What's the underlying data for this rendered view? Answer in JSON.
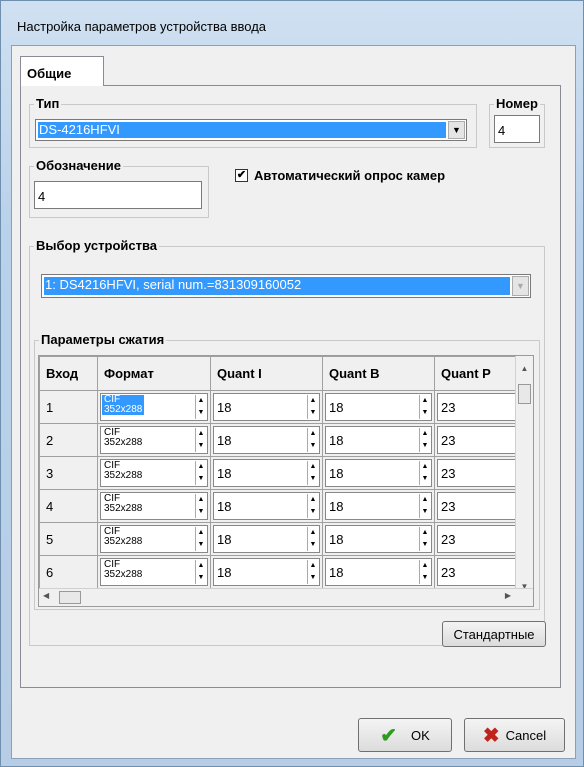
{
  "window": {
    "title": "Настройка параметров устройства ввода"
  },
  "tabs": [
    {
      "label": "Общие"
    }
  ],
  "type": {
    "label": "Тип",
    "value": "DS-4216HFVI"
  },
  "number": {
    "label": "Номер",
    "value": "4"
  },
  "designation": {
    "label": "Обозначение",
    "value": "4"
  },
  "auto_poll": {
    "label": "Автоматический опрос камер",
    "checked": true
  },
  "device_select": {
    "label": "Выбор устройства",
    "value": "1: DS4216HFVI, serial num.=831309160052"
  },
  "compression": {
    "label": "Параметры сжатия",
    "columns": [
      "Вход",
      "Формат",
      "Quant I",
      "Quant B",
      "Quant P"
    ],
    "rows": [
      {
        "input": "1",
        "format_name": "CIF",
        "format_res": "352x288",
        "quant_i": "18",
        "quant_b": "18",
        "quant_p": "23"
      },
      {
        "input": "2",
        "format_name": "CIF",
        "format_res": "352x288",
        "quant_i": "18",
        "quant_b": "18",
        "quant_p": "23"
      },
      {
        "input": "3",
        "format_name": "CIF",
        "format_res": "352x288",
        "quant_i": "18",
        "quant_b": "18",
        "quant_p": "23"
      },
      {
        "input": "4",
        "format_name": "CIF",
        "format_res": "352x288",
        "quant_i": "18",
        "quant_b": "18",
        "quant_p": "23"
      },
      {
        "input": "5",
        "format_name": "CIF",
        "format_res": "352x288",
        "quant_i": "18",
        "quant_b": "18",
        "quant_p": "23"
      },
      {
        "input": "6",
        "format_name": "CIF",
        "format_res": "352x288",
        "quant_i": "18",
        "quant_b": "18",
        "quant_p": "23"
      }
    ]
  },
  "buttons": {
    "defaults": "Стандартные",
    "ok": "OK",
    "cancel": "Cancel"
  },
  "colors": {
    "selection": "#3399ff",
    "ok_check": "#2e9b1f",
    "cancel_x": "#c0231c"
  }
}
